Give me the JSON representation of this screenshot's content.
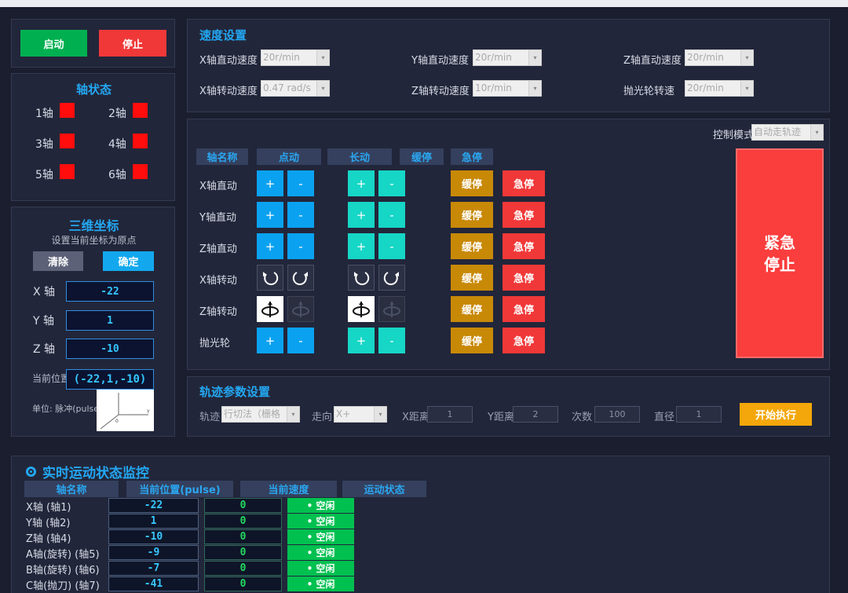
{
  "control": {
    "start": "启动",
    "stop": "停止"
  },
  "axis_status": {
    "title": "轴状态",
    "axes": [
      "1轴",
      "2轴",
      "3轴",
      "4轴",
      "5轴",
      "6轴"
    ],
    "indicator_color": "#ff0d0d"
  },
  "coords": {
    "title": "三维坐标",
    "subtitle": "设置当前坐标为原点",
    "clear": "清除",
    "confirm": "确定",
    "x_label": "X 轴",
    "x_value": "-22",
    "y_label": "Y 轴",
    "y_value": "1",
    "z_label": "Z 轴",
    "z_value": "-10",
    "current_label": "当前位置",
    "current_value": "(-22,1,-10)",
    "unit": "单位: 脉冲(pulse)"
  },
  "speed": {
    "title": "速度设置",
    "x_linear_label": "X轴直动速度",
    "x_linear_value": "20r/min",
    "y_linear_label": "Y轴直动速度",
    "y_linear_value": "20r/min",
    "z_linear_label": "Z轴直动速度",
    "z_linear_value": "20r/min",
    "x_rot_label": "X轴转动速度",
    "x_rot_value": "0.47  rad/s",
    "z_rot_label": "Z轴转动速度",
    "z_rot_value": "10r/min",
    "polish_label": "抛光轮转速",
    "polish_value": "20r/min"
  },
  "jog": {
    "control_mode_label": "控制模式",
    "control_mode_value": "自动走轨迹",
    "headers": {
      "axis": "轴名称",
      "point": "点动",
      "long": "长动",
      "slow": "缓停",
      "estop": "急停"
    },
    "rows": [
      {
        "name": "X轴直动",
        "kind": "linear"
      },
      {
        "name": "Y轴直动",
        "kind": "linear"
      },
      {
        "name": "Z轴直动",
        "kind": "linear"
      },
      {
        "name": "X轴转动",
        "kind": "rotate"
      },
      {
        "name": "Z轴转动",
        "kind": "spin"
      },
      {
        "name": "抛光轮",
        "kind": "linear"
      }
    ],
    "plus": "+",
    "minus": "-",
    "slow_btn": "缓停",
    "estop_btn": "急停",
    "emergency_line1": "紧急",
    "emergency_line2": "停止"
  },
  "trajectory": {
    "title": "轨迹参数设置",
    "path_label": "轨迹",
    "path_value": "行切法（栅格",
    "dir_label": "走向",
    "dir_value": "X+",
    "xdist_label": "X距离",
    "xdist_value": "1",
    "ydist_label": "Y距离",
    "ydist_value": "2",
    "count_label": "次数",
    "count_value": "100",
    "diameter_label": "直径",
    "diameter_value": "1",
    "start_btn": "开始执行"
  },
  "monitor": {
    "title": "实时运动状态监控",
    "headers": [
      "轴名称",
      "当前位置(pulse)",
      "当前速度",
      "运动状态"
    ],
    "rows": [
      {
        "name": "X轴 (轴1)",
        "pos": "-22",
        "speed": "0",
        "state": "• 空闲"
      },
      {
        "name": "Y轴 (轴2)",
        "pos": "1",
        "speed": "0",
        "state": "• 空闲"
      },
      {
        "name": "Z轴 (轴4)",
        "pos": "-10",
        "speed": "0",
        "state": "• 空闲"
      },
      {
        "name": "A轴(旋转) (轴5)",
        "pos": "-9",
        "speed": "0",
        "state": "• 空闲"
      },
      {
        "name": "B轴(旋转) (轴6)",
        "pos": "-7",
        "speed": "0",
        "state": "• 空闲"
      },
      {
        "name": "C轴(抛刀) (轴7)",
        "pos": "-41",
        "speed": "0",
        "state": "• 空闲"
      }
    ]
  },
  "colors": {
    "start_green": "#00b050",
    "stop_red": "#f03838",
    "accent_blue": "#23a7f2",
    "idle_green": "#00c050"
  }
}
